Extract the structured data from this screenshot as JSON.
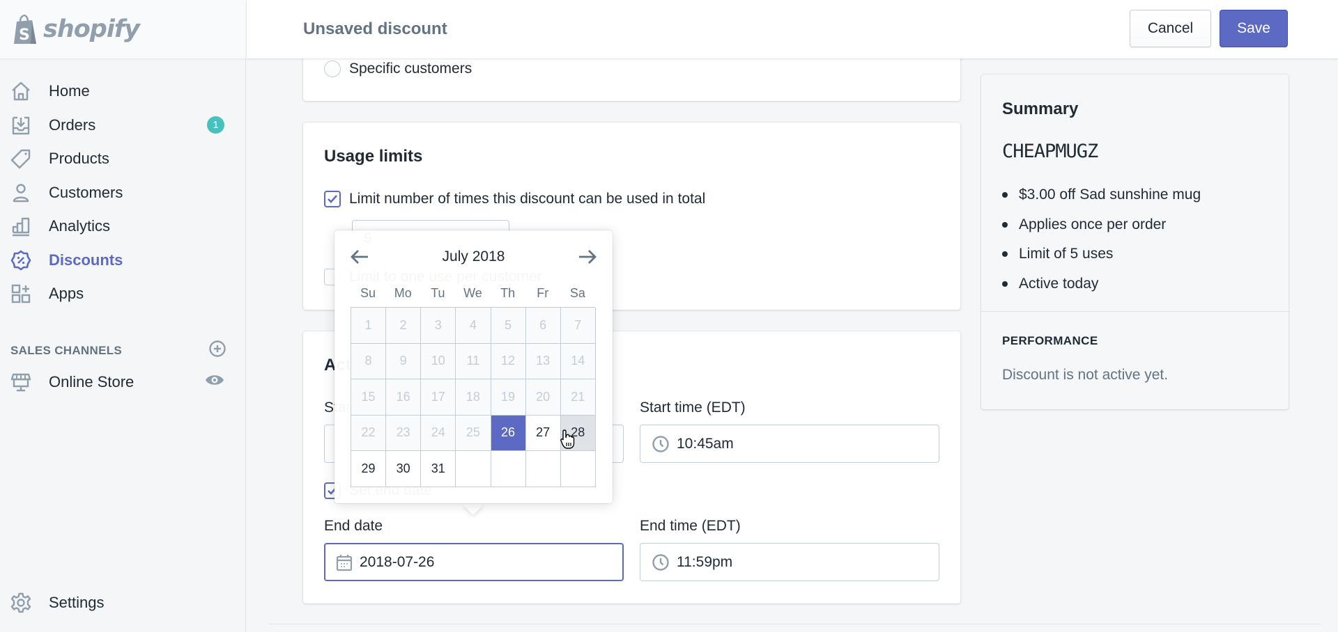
{
  "app": {
    "logo_text": "shopify"
  },
  "sidebar": {
    "items": [
      {
        "label": "Home",
        "icon": "home-icon"
      },
      {
        "label": "Orders",
        "icon": "orders-icon",
        "badge": "1"
      },
      {
        "label": "Products",
        "icon": "tag-icon"
      },
      {
        "label": "Customers",
        "icon": "person-icon"
      },
      {
        "label": "Analytics",
        "icon": "bar-chart-icon"
      },
      {
        "label": "Discounts",
        "icon": "discount-icon",
        "active": true
      },
      {
        "label": "Apps",
        "icon": "apps-icon"
      }
    ],
    "sales_channels_label": "SALES CHANNELS",
    "online_store_label": "Online Store",
    "settings_label": "Settings"
  },
  "header": {
    "title": "Unsaved discount",
    "cancel_label": "Cancel",
    "save_label": "Save"
  },
  "customer_eligibility": {
    "specific_customers_label": "Specific customers"
  },
  "usage_limits": {
    "title": "Usage limits",
    "limit_total_label": "Limit number of times this discount can be used in total",
    "limit_total_checked": true,
    "limit_total_value": "5",
    "limit_per_customer_label": "Limit to one use per customer",
    "limit_per_customer_checked": false
  },
  "active_dates": {
    "title": "Active dates",
    "start_date_label": "Start date",
    "start_time_label": "Start time (EDT)",
    "start_time_value": "10:45am",
    "set_end_date_label": "Set end date",
    "set_end_date_checked": true,
    "end_date_label": "End date",
    "end_date_value": "2018-07-26",
    "end_time_label": "End time (EDT)",
    "end_time_value": "11:59pm"
  },
  "date_picker": {
    "month_title": "July 2018",
    "weekdays": [
      "Su",
      "Mo",
      "Tu",
      "We",
      "Th",
      "Fr",
      "Sa"
    ],
    "days": [
      "1",
      "2",
      "3",
      "4",
      "5",
      "6",
      "7",
      "8",
      "9",
      "10",
      "11",
      "12",
      "13",
      "14",
      "15",
      "16",
      "17",
      "18",
      "19",
      "20",
      "21",
      "22",
      "23",
      "24",
      "25",
      "26",
      "27",
      "28",
      "29",
      "30",
      "31",
      "",
      "",
      "",
      ""
    ],
    "disabled_through": 25,
    "selected_day": 26,
    "hovered_day": 28
  },
  "summary": {
    "title": "Summary",
    "code": "CHEAPMUGZ",
    "items": [
      "$3.00 off Sad sunshine mug",
      "Applies once per order",
      "Limit of 5 uses",
      "Active today"
    ],
    "performance_title": "PERFORMANCE",
    "performance_text": "Discount is not active yet."
  },
  "colors": {
    "accent": "#5c6ac4",
    "badge": "#47c1bf",
    "text": "#212b36",
    "subdued": "#637381"
  }
}
